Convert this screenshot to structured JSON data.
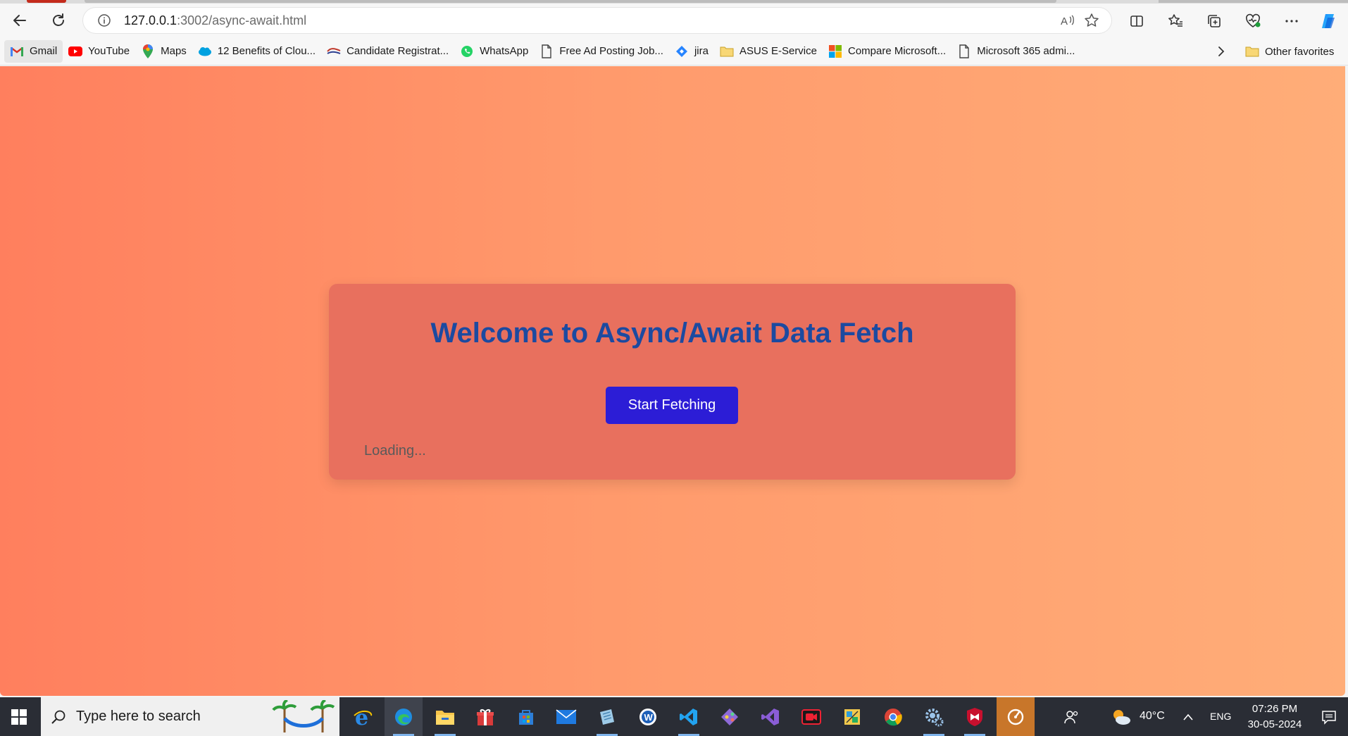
{
  "browser": {
    "url_host": "127.0.0.1",
    "url_path": ":3002/async-await.html",
    "bookmarks": [
      {
        "label": "Gmail",
        "icon": "gmail-icon"
      },
      {
        "label": "YouTube",
        "icon": "youtube-icon"
      },
      {
        "label": "Maps",
        "icon": "maps-icon"
      },
      {
        "label": "12 Benefits of Clou...",
        "icon": "salesforce-icon"
      },
      {
        "label": "Candidate Registrat...",
        "icon": "site-icon"
      },
      {
        "label": "WhatsApp",
        "icon": "whatsapp-icon"
      },
      {
        "label": "Free Ad Posting Job...",
        "icon": "page-icon"
      },
      {
        "label": "jira",
        "icon": "jira-icon"
      },
      {
        "label": "ASUS E-Service",
        "icon": "folder-icon"
      },
      {
        "label": "Compare Microsoft...",
        "icon": "microsoft-icon"
      },
      {
        "label": "Microsoft 365 admi...",
        "icon": "page-icon"
      }
    ],
    "other_favorites": "Other favorites"
  },
  "page": {
    "heading": "Welcome to Async/Await Data Fetch",
    "button_label": "Start Fetching",
    "status": "Loading..."
  },
  "taskbar": {
    "search_placeholder": "Type here to search",
    "temperature": "40°C",
    "language": "ENG",
    "time": "07:26 PM",
    "date": "30-05-2024"
  },
  "colors": {
    "heading": "#1c4aa0",
    "button": "#2c1dd6",
    "card": "#e8705e",
    "gradient_start": "#ff7f5e",
    "gradient_end": "#ffad78"
  }
}
